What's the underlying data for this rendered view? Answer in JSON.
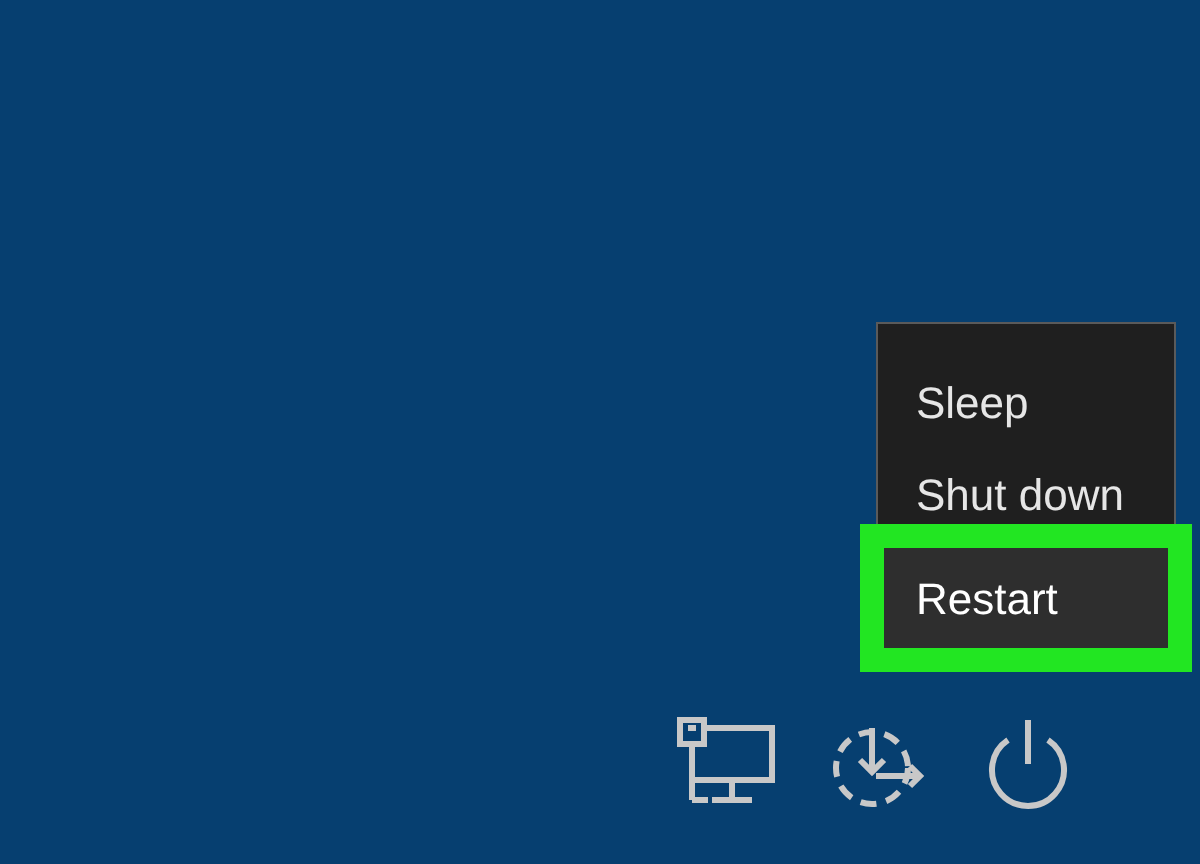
{
  "power_menu": {
    "items": [
      {
        "label": "Sleep",
        "selected": false,
        "highlighted": false
      },
      {
        "label": "Shut down",
        "selected": false,
        "highlighted": false
      },
      {
        "label": "Restart",
        "selected": true,
        "highlighted": true
      }
    ]
  }
}
